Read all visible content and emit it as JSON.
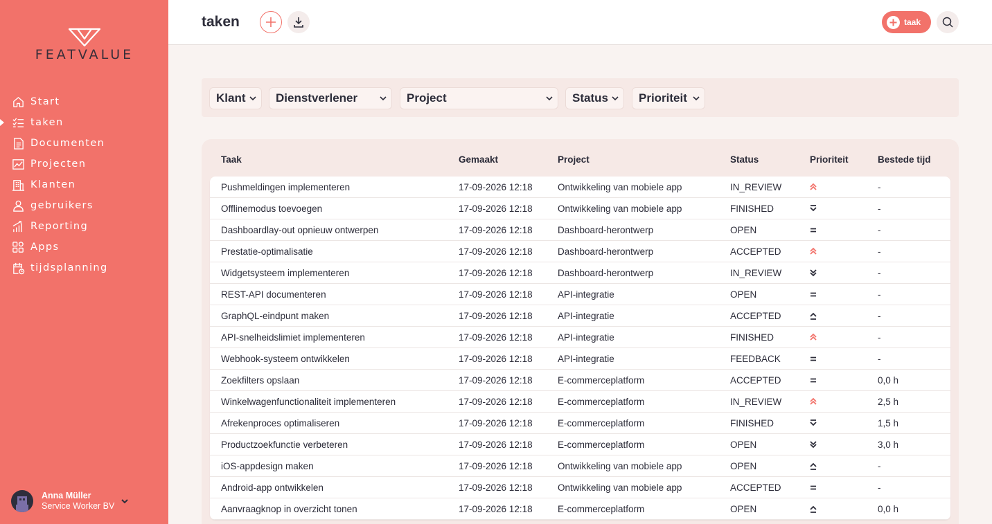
{
  "brand": {
    "name": "FEATVALUE"
  },
  "sidebar": {
    "items": [
      {
        "label": "Start",
        "icon": "home-icon"
      },
      {
        "label": "taken",
        "icon": "checklist-icon",
        "active": true
      },
      {
        "label": "Documenten",
        "icon": "document-icon"
      },
      {
        "label": "Projecten",
        "icon": "chart-icon"
      },
      {
        "label": "Klanten",
        "icon": "building-icon"
      },
      {
        "label": "gebruikers",
        "icon": "user-icon"
      },
      {
        "label": "Reporting",
        "icon": "bar-chart-icon"
      },
      {
        "label": "Apps",
        "icon": "apps-icon"
      },
      {
        "label": "tijdsplanning",
        "icon": "calendar-clock-icon"
      }
    ]
  },
  "user": {
    "name": "Anna Müller",
    "org": "Service Worker BV"
  },
  "header": {
    "title": "taken",
    "task_button_label": "taak"
  },
  "filters": {
    "klant": "Klant",
    "dienstverlener": "Dienstverlener",
    "project": "Project",
    "status": "Status",
    "prioriteit": "Prioriteit"
  },
  "table": {
    "headers": {
      "taak": "Taak",
      "gemaakt": "Gemaakt",
      "project": "Project",
      "status": "Status",
      "prioriteit": "Prioriteit",
      "tijd": "Bestede tijd"
    },
    "rows": [
      {
        "taak": "Pushmeldingen implementeren",
        "gemaakt": "17-09-2026 12:18",
        "project": "Ontwikkeling van mobiele app",
        "status": "IN_REVIEW",
        "prioriteit": "highest",
        "tijd": "-"
      },
      {
        "taak": "Offlinemodus toevoegen",
        "gemaakt": "17-09-2026 12:18",
        "project": "Ontwikkeling van mobiele app",
        "status": "FINISHED",
        "prioriteit": "low",
        "tijd": "-"
      },
      {
        "taak": "Dashboardlay-out opnieuw ontwerpen",
        "gemaakt": "17-09-2026 12:18",
        "project": "Dashboard-herontwerp",
        "status": "OPEN",
        "prioriteit": "medium",
        "tijd": "-"
      },
      {
        "taak": "Prestatie-optimalisatie",
        "gemaakt": "17-09-2026 12:18",
        "project": "Dashboard-herontwerp",
        "status": "ACCEPTED",
        "prioriteit": "highest",
        "tijd": "-"
      },
      {
        "taak": "Widgetsysteem implementeren",
        "gemaakt": "17-09-2026 12:18",
        "project": "Dashboard-herontwerp",
        "status": "IN_REVIEW",
        "prioriteit": "lowest",
        "tijd": "-"
      },
      {
        "taak": "REST-API documenteren",
        "gemaakt": "17-09-2026 12:18",
        "project": "API-integratie",
        "status": "OPEN",
        "prioriteit": "medium",
        "tijd": "-"
      },
      {
        "taak": "GraphQL-eindpunt maken",
        "gemaakt": "17-09-2026 12:18",
        "project": "API-integratie",
        "status": "ACCEPTED",
        "prioriteit": "high",
        "tijd": "-"
      },
      {
        "taak": "API-snelheidslimiet implementeren",
        "gemaakt": "17-09-2026 12:18",
        "project": "API-integratie",
        "status": "FINISHED",
        "prioriteit": "highest",
        "tijd": "-"
      },
      {
        "taak": "Webhook-systeem ontwikkelen",
        "gemaakt": "17-09-2026 12:18",
        "project": "API-integratie",
        "status": "FEEDBACK",
        "prioriteit": "medium",
        "tijd": "-"
      },
      {
        "taak": "Zoekfilters opslaan",
        "gemaakt": "17-09-2026 12:18",
        "project": "E-commerceplatform",
        "status": "ACCEPTED",
        "prioriteit": "medium",
        "tijd": "0,0 h"
      },
      {
        "taak": "Winkelwagenfunctionaliteit implementeren",
        "gemaakt": "17-09-2026 12:18",
        "project": "E-commerceplatform",
        "status": "IN_REVIEW",
        "prioriteit": "highest",
        "tijd": "2,5 h"
      },
      {
        "taak": "Afrekenproces optimaliseren",
        "gemaakt": "17-09-2026 12:18",
        "project": "E-commerceplatform",
        "status": "FINISHED",
        "prioriteit": "low",
        "tijd": "1,5 h"
      },
      {
        "taak": "Productzoekfunctie verbeteren",
        "gemaakt": "17-09-2026 12:18",
        "project": "E-commerceplatform",
        "status": "OPEN",
        "prioriteit": "lowest",
        "tijd": "3,0 h"
      },
      {
        "taak": "iOS-appdesign maken",
        "gemaakt": "17-09-2026 12:18",
        "project": "Ontwikkeling van mobiele app",
        "status": "OPEN",
        "prioriteit": "high",
        "tijd": "-"
      },
      {
        "taak": "Android-app ontwikkelen",
        "gemaakt": "17-09-2026 12:18",
        "project": "Ontwikkeling van mobiele app",
        "status": "ACCEPTED",
        "prioriteit": "medium",
        "tijd": "-"
      },
      {
        "taak": "Aanvraagknop in overzicht tonen",
        "gemaakt": "17-09-2026 12:18",
        "project": "E-commerceplatform",
        "status": "OPEN",
        "prioriteit": "high",
        "tijd": "0,0 h"
      }
    ]
  },
  "colors": {
    "accent": "#f2726a",
    "text": "#2d2d3a",
    "page": "#f9f3f1"
  }
}
